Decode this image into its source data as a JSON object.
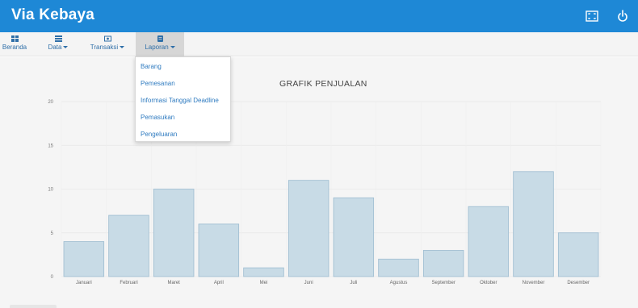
{
  "app": {
    "brand": "Via Kebaya"
  },
  "topbar": {
    "icons": [
      "fullscreen-icon",
      "power-icon"
    ],
    "color": "#1e88d6"
  },
  "nav": {
    "items": [
      {
        "label": "Beranda",
        "icon": "dashboard-icon",
        "dropdown": false
      },
      {
        "label": "Data",
        "icon": "database-icon",
        "dropdown": true
      },
      {
        "label": "Transaksi",
        "icon": "money-icon",
        "dropdown": true
      },
      {
        "label": "Laporan",
        "icon": "report-icon",
        "dropdown": true,
        "active": true
      }
    ]
  },
  "laporan_menu": {
    "items": [
      {
        "label": "Barang"
      },
      {
        "label": "Pemesanan"
      },
      {
        "label": "Informasi Tanggal Deadline"
      },
      {
        "label": "Pemasukan"
      },
      {
        "label": "Pengeluaran"
      }
    ]
  },
  "chart_data": {
    "type": "bar",
    "title": "GRAFIK PENJUALAN",
    "categories": [
      "Januari",
      "Februari",
      "Maret",
      "April",
      "Mei",
      "Juni",
      "Juli",
      "Agustus",
      "September",
      "Oktober",
      "November",
      "Desember"
    ],
    "values": [
      4,
      7,
      10,
      6,
      1,
      11,
      9,
      2,
      3,
      8,
      12,
      5
    ],
    "xlabel": "",
    "ylabel": "",
    "ylim": [
      0,
      20
    ],
    "yticks": [
      0,
      5,
      10,
      15,
      20
    ],
    "grid": true,
    "bar_color": "#c8dbe6",
    "bar_border": "#9dbcd0"
  }
}
